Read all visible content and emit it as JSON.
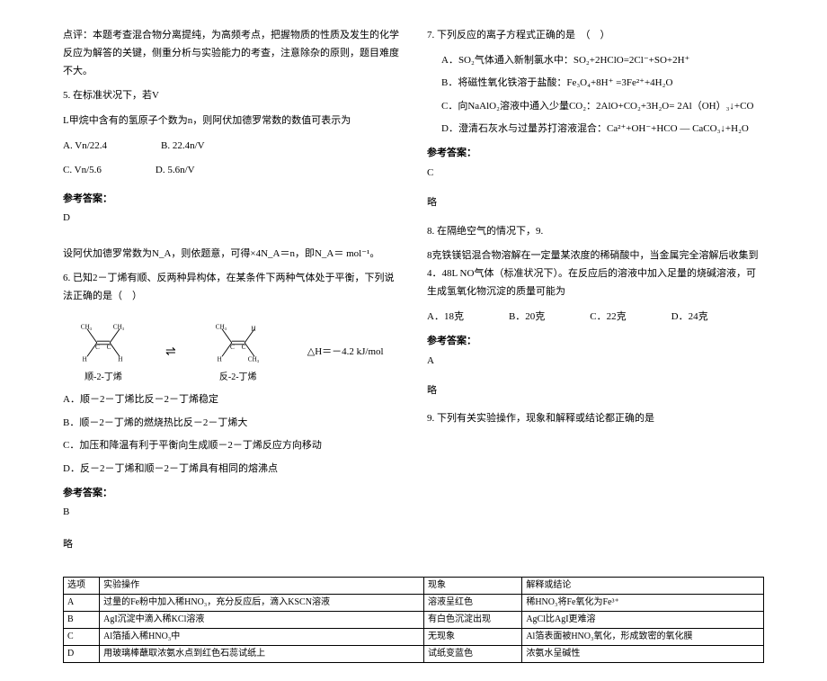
{
  "left": {
    "comment": "点评：本题考查混合物分离提纯，为高频考点，把握物质的性质及发生的化学反应为解答的关键，侧重分析与实验能力的考查，注意除杂的原则，题目难度不大。",
    "q5_stem": "5. 在标准状况下，若V",
    "q5_line2": "L甲烷中含有的氢原子个数为n，则阿伏加德罗常数的数值可表示为",
    "q5_optA": "A. Vn/22.4",
    "q5_optB": "B. 22.4n/V",
    "q5_optC": "C. Vn/5.6",
    "q5_optD": "D. 5.6n/V",
    "ans_label": "参考答案：",
    "q5_ans": "D",
    "q5_expl": "设阿伏加德罗常数为N_A，则依题意，可得×4N_A＝n，即N_A＝ mol⁻¹。",
    "q6_stem": "6. 已知2－丁烯有顺、反两种异构体，在某条件下两种气体处于平衡，下列说法正确的是（　）",
    "mol1_label": "顺-2-丁烯",
    "mol2_label": "反-2-丁烯",
    "dh": "△H＝－4.2 kJ/mol",
    "q6_optA": "A．顺－2－丁烯比反－2－丁烯稳定",
    "q6_optB": "B．顺－2－丁烯的燃烧热比反－2－丁烯大",
    "q6_optC": "C．加压和降温有利于平衡向生成顺－2－丁烯反应方向移动",
    "q6_optD": "D．反－2－丁烯和顺－2－丁烯具有相同的熔沸点",
    "q6_ans": "B",
    "略": "略"
  },
  "right": {
    "q7_stem": "7. 下列反应的离子方程式正确的是　（　）",
    "q7_optA": "A．SO₂气体通入新制氯水中：SO₂+2HClO=2Cl⁻+SO+2H⁺",
    "q7_optB": "B．将磁性氧化铁溶于盐酸：Fe₃O₄+8H⁺ =3Fe²⁺+4H₂O",
    "q7_optC": "C．向NaAlO₂溶液中通入少量CO₂：2AlO+CO₂+3H₂O= 2Al（OH）₃↓+CO",
    "q7_optD": "D．澄清石灰水与过量苏打溶液混合：Ca²⁺+OH⁻+HCO — CaCO₃↓+H₂O",
    "ans_label": "参考答案：",
    "q7_ans": "C",
    "q8_stem1": "8. 在隔绝空气的情况下，9.",
    "q8_stem2": "8克铁镁铝混合物溶解在一定量某浓度的稀硝酸中，当金属完全溶解后收集到4．48L NO气体（标准状况下）。在反应后的溶液中加入足量的烧碱溶液，可生成氢氧化物沉淀的质量可能为",
    "q8_optA": "A．18克",
    "q8_optB": "B．20克",
    "q8_optC": "C．22克",
    "q8_optD": "D．24克",
    "q8_ans": "A",
    "q9_stem": "9. 下列有关实验操作，现象和解释或结论都正确的是"
  },
  "table": {
    "h1": "选项",
    "h2": "实验操作",
    "h3": "现象",
    "h4": "解释或结论",
    "rows": [
      {
        "a": "A",
        "b": "过量的Fe粉中加入稀HNO₃，充分反应后，滴入KSCN溶液",
        "c": "溶液呈红色",
        "d": "稀HNO₃将Fe氧化为Fe³⁺"
      },
      {
        "a": "B",
        "b": "AgI沉淀中滴入稀KCl溶液",
        "c": "有白色沉淀出现",
        "d": "AgCl比AgI更难溶"
      },
      {
        "a": "C",
        "b": "Al箔插入稀HNO₃中",
        "c": "无现象",
        "d": "Al箔表面被HNO₃氧化，形成致密的氧化膜"
      },
      {
        "a": "D",
        "b": "用玻璃棒蘸取浓氨水点到红色石蕊试纸上",
        "c": "试纸变蓝色",
        "d": "浓氨水呈碱性"
      }
    ]
  }
}
